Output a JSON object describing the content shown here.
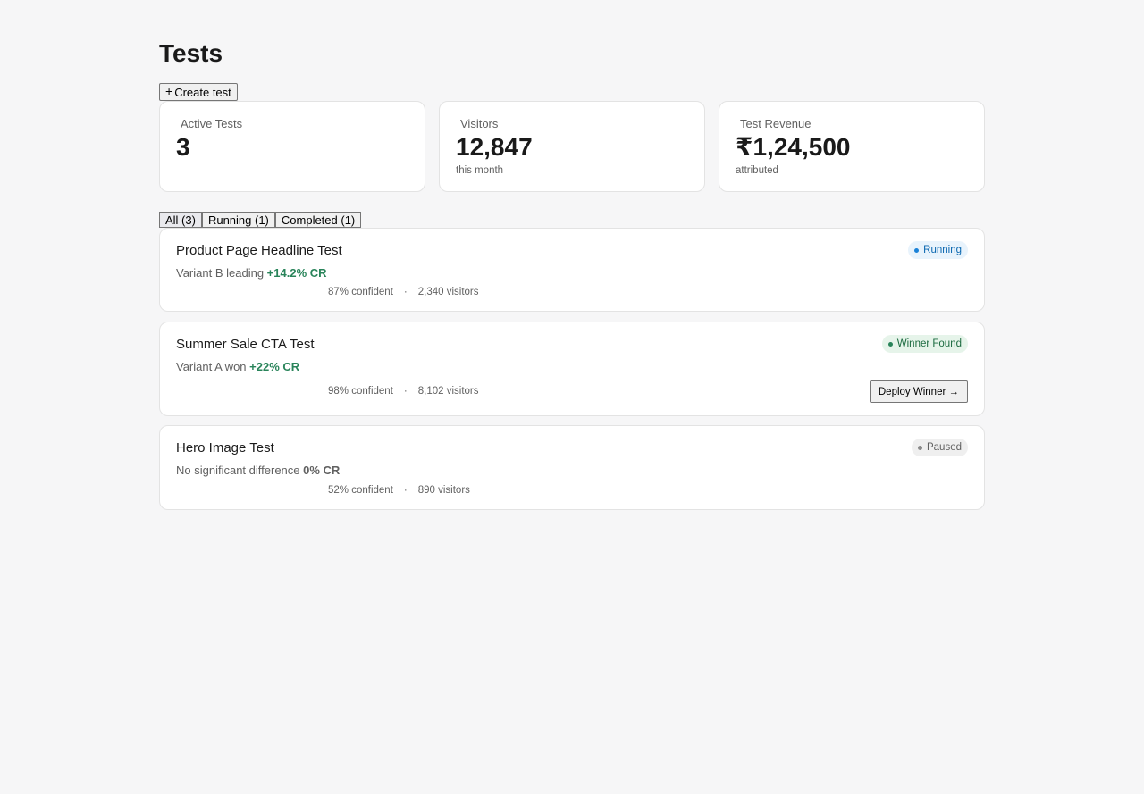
{
  "page": {
    "title": "Tests"
  },
  "create_button": {
    "icon": "plus-icon",
    "label": "Create test"
  },
  "stats": [
    {
      "label": "Active Tests",
      "value": "3",
      "sub": ""
    },
    {
      "label": "Visitors",
      "value": "12,847",
      "sub": "this month"
    },
    {
      "label": "Test Revenue",
      "value": "₹1,24,500",
      "sub": "attributed"
    }
  ],
  "tabs": [
    {
      "label": "All (3)",
      "selected": true
    },
    {
      "label": "Running (1)",
      "selected": false
    },
    {
      "label": "Completed (1)",
      "selected": false
    }
  ],
  "tests": [
    {
      "name": "Product Page Headline Test",
      "status": "Running",
      "summary": "Variant B leading",
      "lift": "+14.2% CR",
      "confidence": "87% confident",
      "separator": "·",
      "visitors": "2,340 visitors"
    },
    {
      "name": "Summer Sale CTA Test",
      "status": "Winner Found",
      "summary": "Variant A won",
      "lift": "+22% CR",
      "confidence": "98% confident",
      "separator": "·",
      "visitors": "8,102 visitors",
      "action": "Deploy Winner →"
    },
    {
      "name": "Hero Image Test",
      "status": "Paused",
      "summary": "No significant difference",
      "lift": "0% CR",
      "confidence": "52% confident",
      "separator": "·",
      "visitors": "890 visitors"
    }
  ],
  "colors": {
    "background": "#f6f6f7",
    "positive": "#29845a",
    "running": "#0a67b0",
    "winner": "#1c6b40",
    "paused": "#616161"
  }
}
